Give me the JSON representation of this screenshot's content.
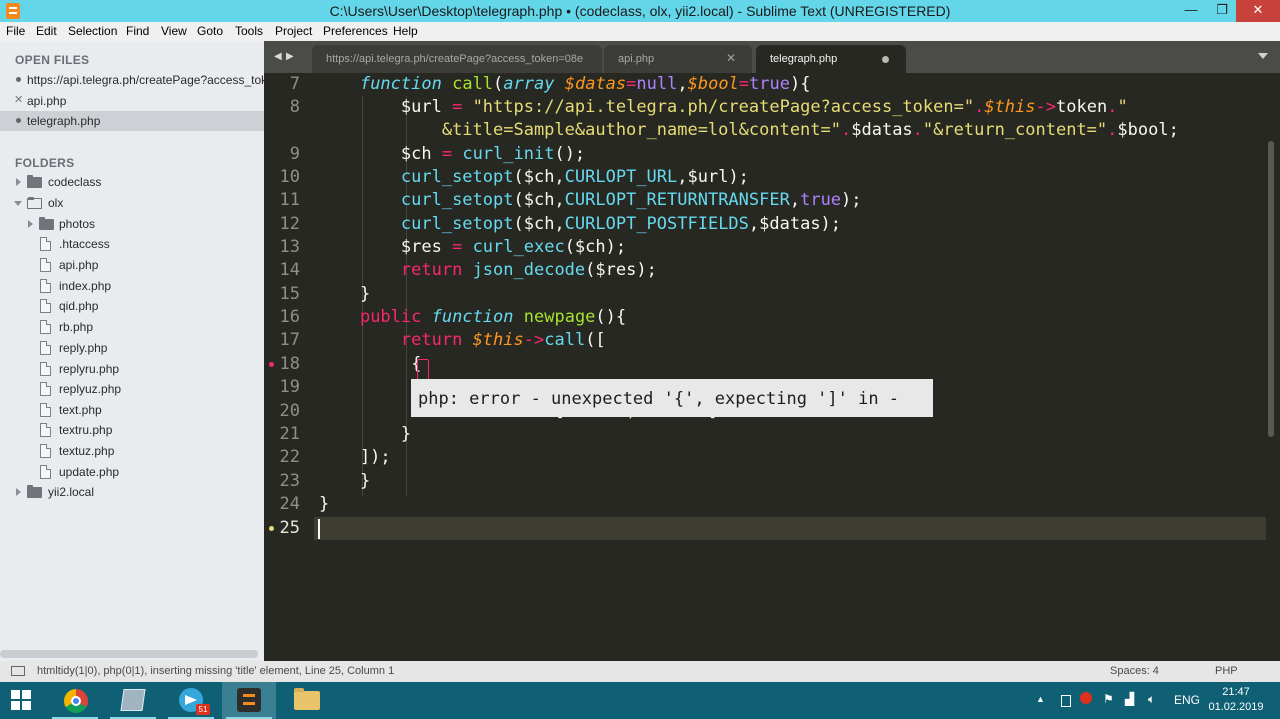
{
  "window": {
    "title": "C:\\Users\\User\\Desktop\\telegraph.php • (codeclass, olx, yii2.local) - Sublime Text (UNREGISTERED)",
    "minimize": "—",
    "maximize": "❐",
    "close": "✕"
  },
  "menu": [
    "File",
    "Edit",
    "Selection",
    "Find",
    "View",
    "Goto",
    "Tools",
    "Project",
    "Preferences",
    "Help"
  ],
  "sidebar": {
    "open_files_heading": "OPEN FILES",
    "open_files": [
      {
        "label": "https://api.telegra.ph/createPage?access_token=",
        "marker": "dot"
      },
      {
        "label": "api.php",
        "marker": "x"
      },
      {
        "label": "telegraph.php",
        "marker": "dot"
      }
    ],
    "folders_heading": "FOLDERS",
    "folders": [
      {
        "label": "codeclass"
      },
      {
        "label": "olx"
      },
      {
        "label": "photos"
      },
      {
        "label": ".htaccess"
      },
      {
        "label": "api.php"
      },
      {
        "label": "index.php"
      },
      {
        "label": "qid.php"
      },
      {
        "label": "rb.php"
      },
      {
        "label": "reply.php"
      },
      {
        "label": "replyru.php"
      },
      {
        "label": "replyuz.php"
      },
      {
        "label": "text.php"
      },
      {
        "label": "textru.php"
      },
      {
        "label": "textuz.php"
      },
      {
        "label": "update.php"
      },
      {
        "label": "yii2.local"
      }
    ]
  },
  "tabs": {
    "nav_left": "◀",
    "nav_right": "▶",
    "items": [
      {
        "label": "https://api.telegra.ph/createPage?access_token=08e"
      },
      {
        "label": "api.php",
        "close": "✕"
      },
      {
        "label": "telegraph.php"
      }
    ]
  },
  "editor": {
    "line_numbers": [
      "7",
      "8",
      "",
      "9",
      "10",
      "11",
      "12",
      "13",
      "14",
      "15",
      "16",
      "17",
      "18",
      "19",
      "20",
      "21",
      "22",
      "23",
      "24",
      "25"
    ],
    "error_tooltip": "php: error - unexpected '{', expecting ']' in -"
  },
  "status": {
    "message": "htmltidy(1|0), php(0|1), inserting missing 'title' element, Line 25, Column 1",
    "spaces": "Spaces: 4",
    "syntax": "PHP"
  },
  "taskbar": {
    "telegram_badge": "51",
    "language": "ENG",
    "time": "21:47",
    "date": "01.02.2019"
  },
  "colors": {
    "titlebar": "#63d6e9",
    "editor_bg": "#272822",
    "keyword": "#f92672",
    "function": "#a6e22e",
    "string": "#e6db74",
    "constant": "#ae81ff",
    "taskbar": "#0f5f75"
  }
}
